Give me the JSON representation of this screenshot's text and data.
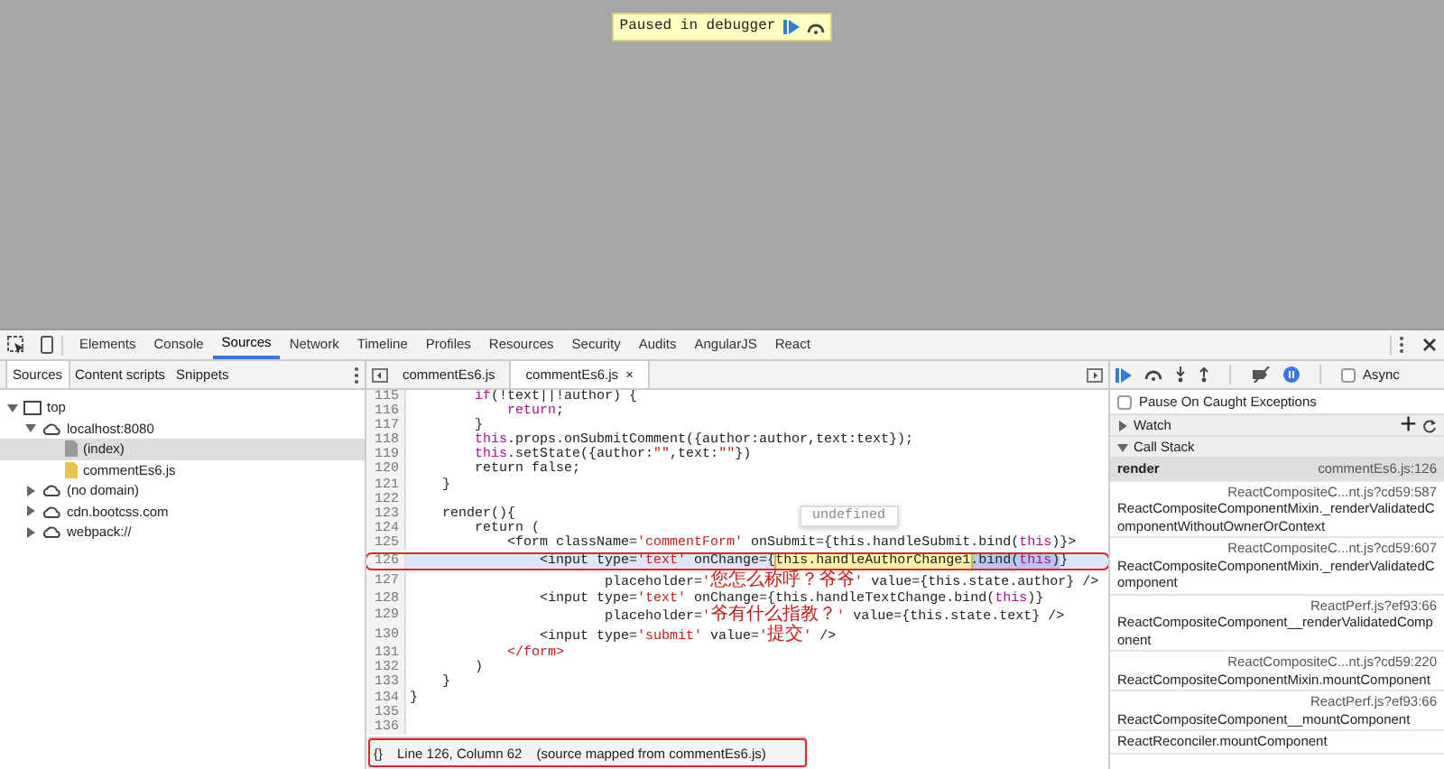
{
  "page_overlay": {
    "message": "Paused in debugger"
  },
  "devtools": {
    "main_tabs": [
      {
        "label": "Elements",
        "selected": false
      },
      {
        "label": "Console",
        "selected": false
      },
      {
        "label": "Sources",
        "selected": true
      },
      {
        "label": "Network",
        "selected": false
      },
      {
        "label": "Timeline",
        "selected": false
      },
      {
        "label": "Profiles",
        "selected": false
      },
      {
        "label": "Resources",
        "selected": false
      },
      {
        "label": "Security",
        "selected": false
      },
      {
        "label": "Audits",
        "selected": false
      },
      {
        "label": "AngularJS",
        "selected": false
      },
      {
        "label": "React",
        "selected": false
      }
    ],
    "navigator": {
      "tabs": [
        {
          "label": "Sources",
          "selected": true
        },
        {
          "label": "Content scripts",
          "selected": false
        },
        {
          "label": "Snippets",
          "selected": false
        }
      ],
      "tree": [
        {
          "label": "top",
          "kind": "frame",
          "expanded": true,
          "selected": false,
          "children": [
            {
              "label": "localhost:8080",
              "kind": "domain",
              "expanded": true,
              "selected": false,
              "children": [
                {
                  "label": "(index)",
                  "kind": "document",
                  "selected": true
                },
                {
                  "label": "commentEs6.js",
                  "kind": "script",
                  "selected": false
                }
              ]
            },
            {
              "label": "(no domain)",
              "kind": "domain",
              "expanded": false,
              "selected": false
            },
            {
              "label": "cdn.bootcss.com",
              "kind": "domain",
              "expanded": false,
              "selected": false
            },
            {
              "label": "webpack://",
              "kind": "domain",
              "expanded": false,
              "selected": false
            }
          ]
        }
      ]
    },
    "editor": {
      "tabs": [
        {
          "label": "commentEs6.js",
          "selected": false,
          "closable": false
        },
        {
          "label": "commentEs6.js",
          "selected": true,
          "closable": true
        }
      ],
      "close_glyph": "×",
      "lines": [
        {
          "number": "115",
          "current": false,
          "segments": [
            {
              "kind": "keyword",
              "text": "        if"
            },
            {
              "kind": "plain",
              "text": "(!text||!author) {"
            }
          ]
        },
        {
          "number": "116",
          "current": false,
          "segments": [
            {
              "kind": "keyword",
              "text": "            return"
            },
            {
              "kind": "plain",
              "text": ";"
            }
          ]
        },
        {
          "number": "117",
          "current": false,
          "segments": [
            {
              "kind": "plain",
              "text": "        }"
            }
          ]
        },
        {
          "number": "118",
          "current": false,
          "segments": [
            {
              "kind": "keyword",
              "text": "        this"
            },
            {
              "kind": "plain",
              "text": ".props.onSubmitComment({author:author,text:text});"
            }
          ]
        },
        {
          "number": "119",
          "current": false,
          "segments": [
            {
              "kind": "keyword",
              "text": "        this"
            },
            {
              "kind": "plain",
              "text": ".setState({author:"
            },
            {
              "kind": "string",
              "text": "\"\""
            },
            {
              "kind": "plain",
              "text": ",text:"
            },
            {
              "kind": "string",
              "text": "\"\""
            },
            {
              "kind": "plain",
              "text": "})"
            }
          ]
        },
        {
          "number": "120",
          "current": false,
          "segments": [
            {
              "kind": "plain",
              "text": "        return false;"
            }
          ]
        },
        {
          "number": "121",
          "current": false,
          "segments": [
            {
              "kind": "plain",
              "text": "    }"
            }
          ]
        },
        {
          "number": "122",
          "current": false
        },
        {
          "number": "123",
          "current": false,
          "segments": [
            {
              "kind": "plain",
              "text": "    render(){"
            }
          ]
        },
        {
          "number": "124",
          "current": false,
          "segments": [
            {
              "kind": "plain",
              "text": "        return ("
            }
          ]
        },
        {
          "number": "125",
          "current": false,
          "segments": [
            {
              "kind": "plain",
              "text": "            <form className="
            },
            {
              "kind": "string",
              "text": "'commentForm'"
            },
            {
              "kind": "plain",
              "text": " onSubmit={this.handleSubmit.bind("
            },
            {
              "kind": "keyword",
              "text": "this"
            },
            {
              "kind": "plain",
              "text": ")}>"
            }
          ]
        },
        {
          "number": "126",
          "current": true,
          "annotated": true,
          "segments": [
            {
              "kind": "plain",
              "text": "                <input type="
            },
            {
              "kind": "string",
              "text": "'text'"
            },
            {
              "kind": "plain",
              "text": " onChange={"
            },
            {
              "kind": "hovered",
              "text": "this.handleAuthorChange1"
            },
            {
              "kind": "selected",
              "text": ".bind("
            },
            {
              "kind": "selected-keyword",
              "text": "this"
            },
            {
              "kind": "selected",
              "text": ")"
            },
            {
              "kind": "plain",
              "text": "}"
            }
          ]
        },
        {
          "number": "127",
          "current": false,
          "segments": [
            {
              "kind": "plain",
              "text": "                        placeholder="
            },
            {
              "kind": "string",
              "text": "'您怎么称呼？爷爷'"
            },
            {
              "kind": "plain",
              "text": " value={this.state.author} />"
            }
          ]
        },
        {
          "number": "128",
          "current": false,
          "segments": [
            {
              "kind": "plain",
              "text": "                <input type="
            },
            {
              "kind": "string",
              "text": "'text'"
            },
            {
              "kind": "plain",
              "text": " onChange={this.handleTextChange.bind("
            },
            {
              "kind": "keyword",
              "text": "this"
            },
            {
              "kind": "plain",
              "text": ")}"
            }
          ]
        },
        {
          "number": "129",
          "current": false,
          "segments": [
            {
              "kind": "plain",
              "text": "                        placeholder="
            },
            {
              "kind": "string",
              "text": "'爷有什么指教？'"
            },
            {
              "kind": "plain",
              "text": " value={this.state.text} />"
            }
          ]
        },
        {
          "number": "130",
          "current": false,
          "segments": [
            {
              "kind": "plain",
              "text": "                <input type="
            },
            {
              "kind": "string",
              "text": "'submit'"
            },
            {
              "kind": "plain",
              "text": " value="
            },
            {
              "kind": "string",
              "text": "'提交'"
            },
            {
              "kind": "plain",
              "text": " />"
            }
          ]
        },
        {
          "number": "131",
          "current": false,
          "segments": [
            {
              "kind": "string",
              "text": "            </form>"
            }
          ]
        },
        {
          "number": "132",
          "current": false,
          "segments": [
            {
              "kind": "plain",
              "text": "        )"
            }
          ]
        },
        {
          "number": "133",
          "current": false,
          "segments": [
            {
              "kind": "plain",
              "text": "    }"
            }
          ]
        },
        {
          "number": "134",
          "current": false,
          "segments": [
            {
              "kind": "plain",
              "text": "}"
            }
          ]
        },
        {
          "number": "135",
          "current": false
        },
        {
          "number": "136",
          "current": false
        }
      ],
      "tooltip": "undefined",
      "status": {
        "format_glyph": "{}",
        "position": "Line 126, Column 62",
        "source_map": "(source mapped from commentEs6.js)",
        "annotated": true
      }
    },
    "debugger": {
      "async": {
        "label": "Async",
        "checked": false
      },
      "pause_on_caught": {
        "label": "Pause On Caught Exceptions",
        "checked": false
      },
      "sections": [
        {
          "title": "Watch",
          "expanded": false,
          "actions": [
            "+"
          ]
        },
        {
          "title": "Call Stack",
          "expanded": true
        }
      ],
      "call_stack": [
        {
          "function": "render",
          "location": "commentEs6.js:126",
          "selected": true
        },
        {
          "function": "ReactCompositeComponentMixin._renderValidatedComponentWithoutOwnerOrContext",
          "location": "ReactCompositeC...nt.js?cd59:587",
          "selected": false
        },
        {
          "function": "ReactCompositeComponentMixin._renderValidatedComponent",
          "location": "ReactCompositeC...nt.js?cd59:607",
          "selected": false
        },
        {
          "function": "ReactCompositeComponent__renderValidatedComponent",
          "location": "ReactPerf.js?ef93:66",
          "selected": false
        },
        {
          "function": "ReactCompositeComponentMixin.mountComponent",
          "location": "ReactCompositeC...nt.js?cd59:220",
          "selected": false
        },
        {
          "function": "ReactCompositeComponent__mountComponent",
          "location": "ReactPerf.js?ef93:66",
          "selected": false
        },
        {
          "function": "ReactReconciler.mountComponent",
          "selected": false
        }
      ]
    }
  }
}
